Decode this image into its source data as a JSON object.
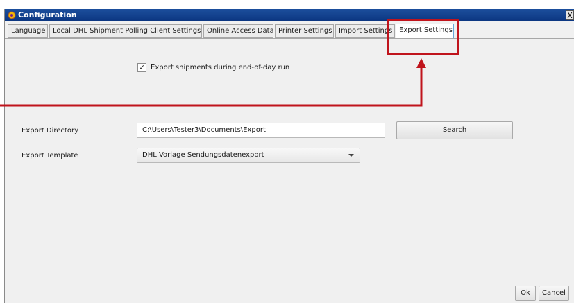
{
  "window": {
    "title": "Configuration",
    "close_label": "X"
  },
  "tabs": [
    {
      "label": "Language"
    },
    {
      "label": "Local DHL Shipment Polling Client Settings"
    },
    {
      "label": "Online Access Data"
    },
    {
      "label": "Printer Settings"
    },
    {
      "label": "Import Settings"
    },
    {
      "label": "Export Settings",
      "active": true
    }
  ],
  "export_settings": {
    "checkbox_label": "Export shipments during end-of-day run",
    "checkbox_checked": true,
    "directory_label": "Export Directory",
    "directory_value": "C:\\Users\\Tester3\\Documents\\Export",
    "search_button": "Search",
    "template_label": "Export Template",
    "template_value": "DHL Vorlage Sendungsdatenexport"
  },
  "footer": {
    "ok_button": "Ok",
    "cancel_button": "Cancel"
  },
  "colors": {
    "annotation": "#c0141c",
    "titlebar": "#0b3580"
  }
}
